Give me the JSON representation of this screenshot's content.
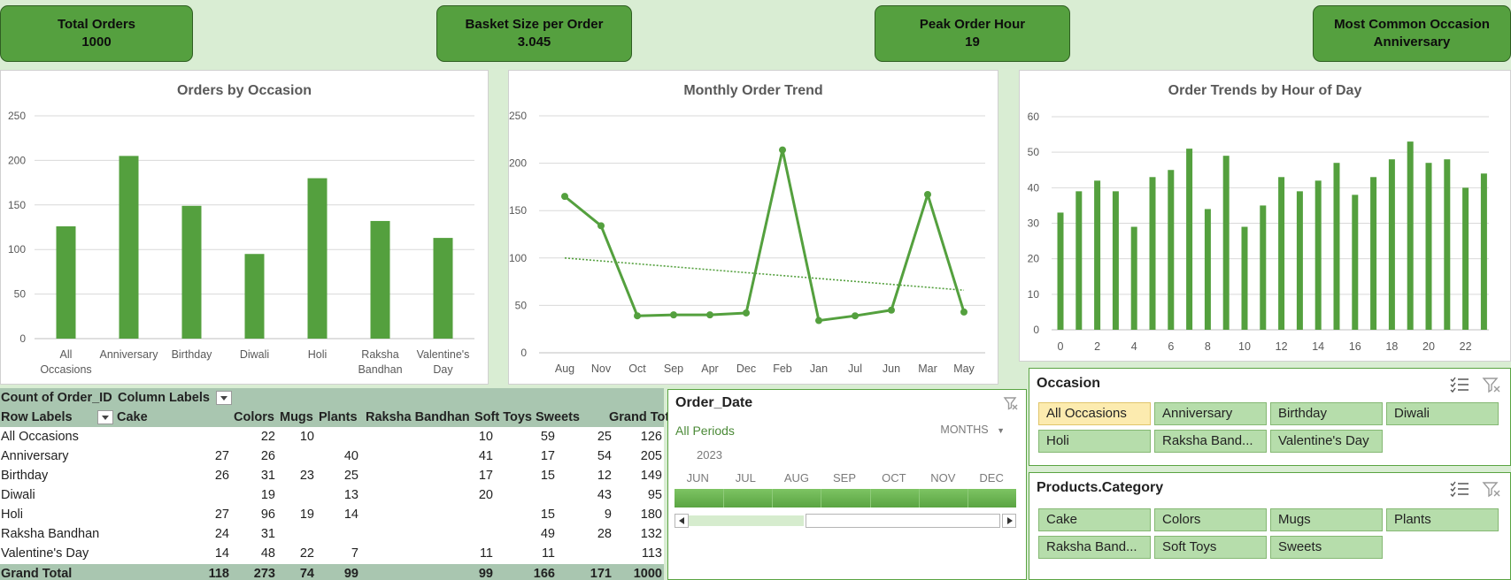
{
  "kpis": {
    "total_orders": {
      "label": "Total Orders",
      "value": "1000"
    },
    "basket_size": {
      "label": "Basket Size per Order",
      "value": "3.045"
    },
    "peak_hour": {
      "label": "Peak Order Hour",
      "value": "19"
    },
    "common_occasion": {
      "label": "Most Common Occasion",
      "value": "Anniversary"
    }
  },
  "chart_data": [
    {
      "type": "bar",
      "title": "Orders by Occasion",
      "categories": [
        "All Occasions",
        "Anniversary",
        "Birthday",
        "Diwali",
        "Holi",
        "Raksha Bandhan",
        "Valentine's Day"
      ],
      "values": [
        126,
        205,
        149,
        95,
        180,
        132,
        113
      ],
      "ylim": [
        0,
        250
      ],
      "yticks": [
        0,
        50,
        100,
        150,
        200,
        250
      ],
      "grid": true,
      "color": "#54a03e"
    },
    {
      "type": "line",
      "title": "Monthly Order Trend",
      "categories": [
        "Aug",
        "Nov",
        "Oct",
        "Sep",
        "Apr",
        "Dec",
        "Feb",
        "Jan",
        "Jul",
        "Jun",
        "Mar",
        "May"
      ],
      "values": [
        165,
        134,
        39,
        40,
        40,
        42,
        214,
        34,
        39,
        45,
        167,
        43
      ],
      "trendline": [
        100,
        66
      ],
      "ylim": [
        0,
        250
      ],
      "yticks": [
        0,
        50,
        100,
        150,
        200,
        250
      ],
      "grid": true,
      "color": "#54a03e"
    },
    {
      "type": "bar",
      "title": "Order Trends by Hour of Day",
      "x": [
        0,
        1,
        2,
        3,
        4,
        5,
        6,
        7,
        8,
        9,
        10,
        11,
        12,
        13,
        14,
        15,
        16,
        17,
        18,
        19,
        20,
        21,
        22,
        23
      ],
      "xtick_labels": [
        "0",
        "2",
        "4",
        "6",
        "8",
        "10",
        "12",
        "14",
        "16",
        "18",
        "20",
        "22"
      ],
      "values": [
        33,
        39,
        42,
        39,
        29,
        43,
        45,
        51,
        34,
        49,
        29,
        35,
        43,
        39,
        42,
        47,
        38,
        43,
        48,
        53,
        47,
        48,
        40,
        44
      ],
      "ylim": [
        0,
        60
      ],
      "yticks": [
        0,
        10,
        20,
        30,
        40,
        50,
        60
      ],
      "grid": true,
      "color": "#54a03e"
    },
    {
      "type": "table",
      "corner": "Count of Order_ID",
      "column_labels": "Column Labels",
      "row_labels": "Row Labels",
      "columns": [
        "Cake",
        "Colors",
        "Mugs",
        "Plants",
        "Raksha Bandhan",
        "Soft Toys",
        "Sweets",
        "Grand Total"
      ],
      "rows": [
        {
          "label": "All Occasions",
          "cells": [
            "",
            "22",
            "10",
            "",
            "10",
            "59",
            "25",
            "126"
          ]
        },
        {
          "label": "Anniversary",
          "cells": [
            "27",
            "26",
            "",
            "40",
            "41",
            "17",
            "54",
            "205"
          ]
        },
        {
          "label": "Birthday",
          "cells": [
            "26",
            "31",
            "23",
            "25",
            "17",
            "15",
            "12",
            "149"
          ]
        },
        {
          "label": "Diwali",
          "cells": [
            "",
            "19",
            "",
            "13",
            "20",
            "",
            "43",
            "95"
          ]
        },
        {
          "label": "Holi",
          "cells": [
            "27",
            "96",
            "19",
            "14",
            "",
            "15",
            "9",
            "180"
          ]
        },
        {
          "label": "Raksha Bandhan",
          "cells": [
            "24",
            "31",
            "",
            "",
            "",
            "49",
            "28",
            "132"
          ]
        },
        {
          "label": "Valentine's Day",
          "cells": [
            "14",
            "48",
            "22",
            "7",
            "11",
            "11",
            "",
            "113"
          ]
        }
      ],
      "grand_total": {
        "label": "Grand Total",
        "cells": [
          "118",
          "273",
          "74",
          "99",
          "99",
          "166",
          "171",
          "1000"
        ]
      }
    }
  ],
  "timeline": {
    "title": "Order_Date",
    "periods": "All Periods",
    "level": "MONTHS",
    "year": "2023",
    "months": [
      "JUN",
      "JUL",
      "AUG",
      "SEP",
      "OCT",
      "NOV",
      "DEC"
    ]
  },
  "slicers": {
    "occasion": {
      "title": "Occasion",
      "items": [
        "All Occasions",
        "Anniversary",
        "Birthday",
        "Diwali",
        "Holi",
        "Raksha Band...",
        "Valentine's Day"
      ],
      "selected": "All Occasions"
    },
    "category": {
      "title": "Products.Category",
      "items": [
        "Cake",
        "Colors",
        "Mugs",
        "Plants",
        "Raksha Band...",
        "Soft Toys",
        "Sweets"
      ]
    }
  },
  "icons": {
    "multi_select": "multi-select-icon",
    "clear_filter": "clear-filter-icon",
    "scroll_left": "arrow-left-icon",
    "scroll_right": "arrow-right-icon"
  }
}
